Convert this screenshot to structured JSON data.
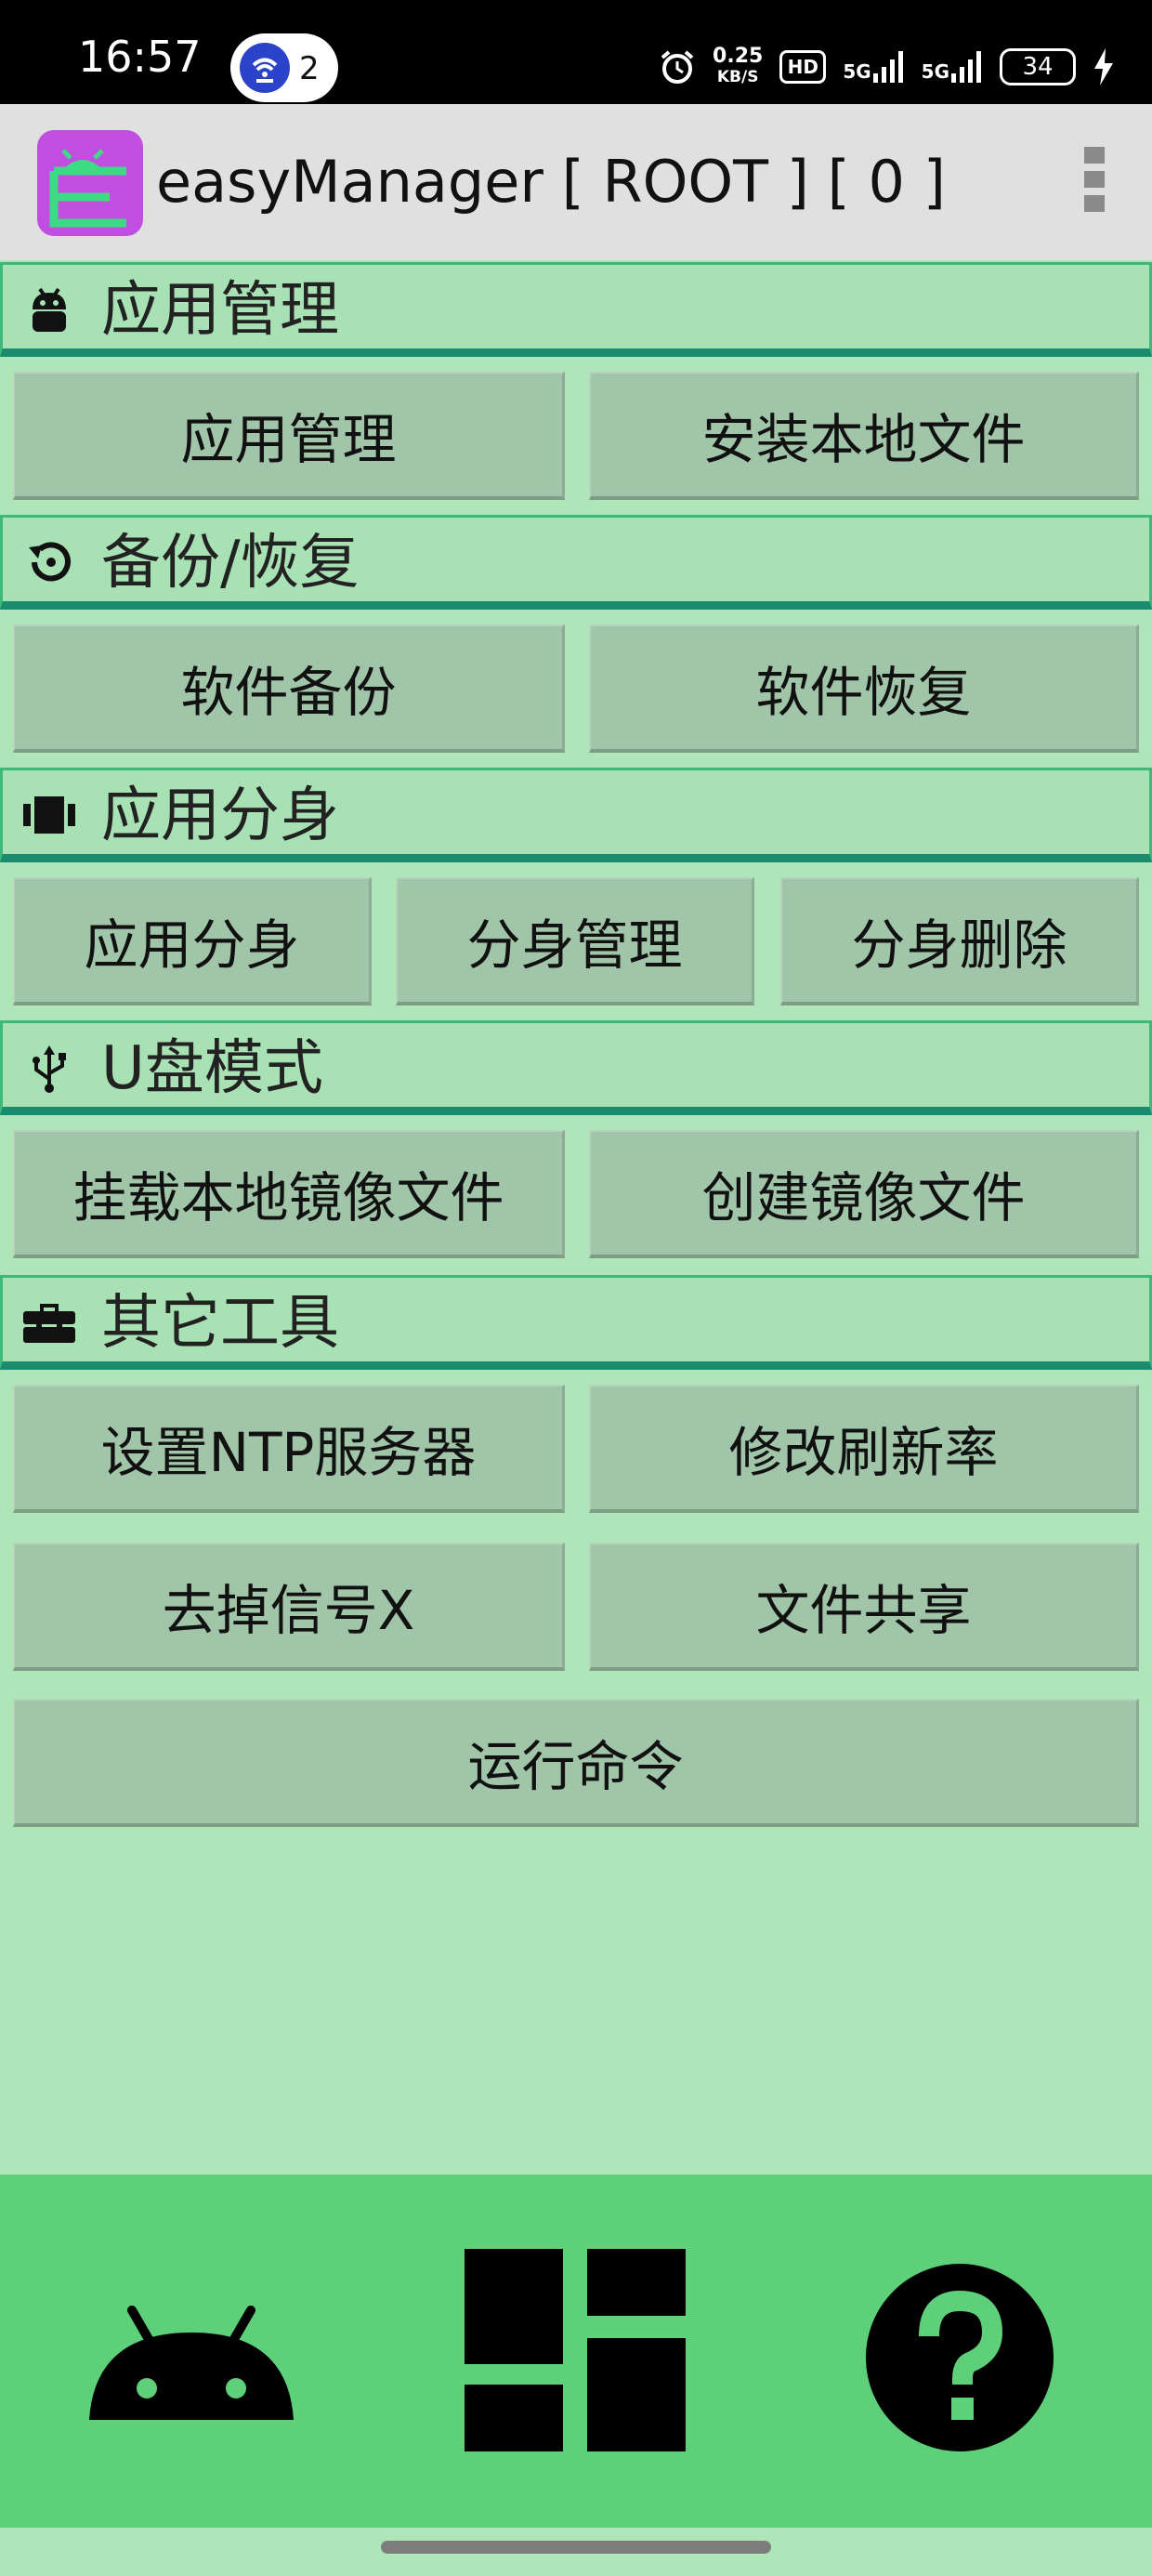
{
  "status_bar": {
    "time": "16:57",
    "hotspot_count": "2",
    "net_speed_value": "0.25",
    "net_speed_unit": "KB/S",
    "hd_label": "HD",
    "signal_1": "5G",
    "signal_2": "5G",
    "battery": "34"
  },
  "app_bar": {
    "title": "easyManager [ ROOT ] [ 0 ]"
  },
  "sections": [
    {
      "title": "应用管理",
      "icon": "android-icon"
    },
    {
      "title": "备份/恢复",
      "icon": "restore-icon"
    },
    {
      "title": "应用分身",
      "icon": "clone-icon"
    },
    {
      "title": "U盘模式",
      "icon": "usb-icon"
    },
    {
      "title": "其它工具",
      "icon": "toolbox-icon"
    }
  ],
  "buttons": {
    "app_manage": "应用管理",
    "install_local": "安装本地文件",
    "backup": "软件备份",
    "restore": "软件恢复",
    "clone_app": "应用分身",
    "clone_manage": "分身管理",
    "clone_delete": "分身删除",
    "mount_image": "挂载本地镜像文件",
    "create_image": "创建镜像文件",
    "ntp_server": "设置NTP服务器",
    "refresh_rate": "修改刷新率",
    "remove_signal_x": "去掉信号X",
    "file_share": "文件共享",
    "run_command": "运行命令"
  },
  "bottom_nav": [
    {
      "icon": "android-icon"
    },
    {
      "icon": "dashboard-icon"
    },
    {
      "icon": "help-icon"
    }
  ],
  "colors": {
    "background": "#aee5b9",
    "section_header": "#a8e2b4",
    "section_underline": "#1a8b6c",
    "button": "#a1c5a8",
    "bottom_nav": "#5fd07a",
    "logo_purple": "#c14ee0",
    "logo_green": "#3ddc84"
  }
}
